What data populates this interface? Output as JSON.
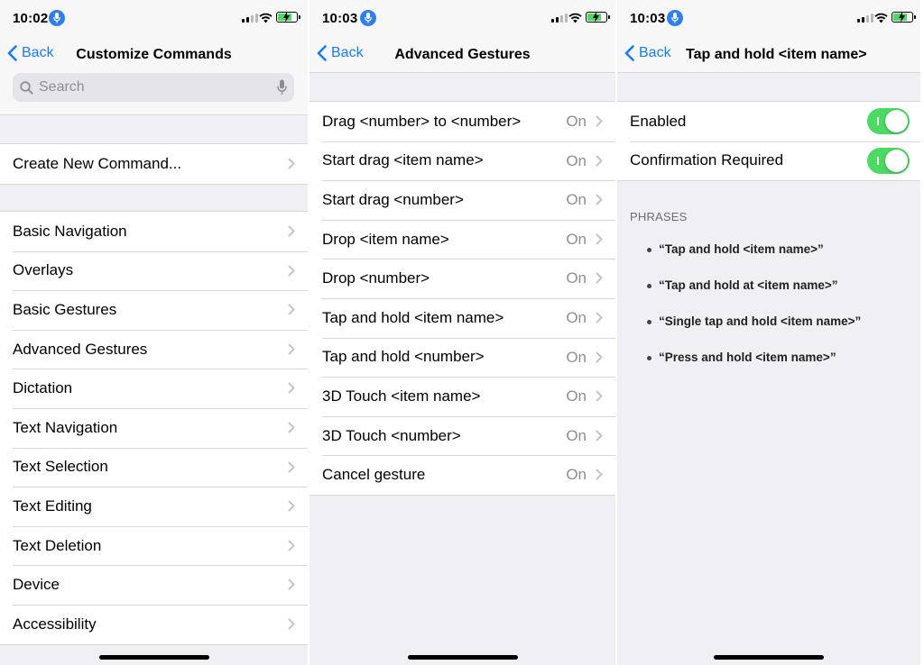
{
  "screens": [
    {
      "status": {
        "time": "10:02"
      },
      "nav": {
        "back": "Back",
        "title": "Customize Commands"
      },
      "search": {
        "placeholder": "Search"
      },
      "top_group": [
        {
          "label": "Create New Command..."
        }
      ],
      "items": [
        {
          "label": "Basic Navigation"
        },
        {
          "label": "Overlays"
        },
        {
          "label": "Basic Gestures"
        },
        {
          "label": "Advanced Gestures"
        },
        {
          "label": "Dictation"
        },
        {
          "label": "Text Navigation"
        },
        {
          "label": "Text Selection"
        },
        {
          "label": "Text Editing"
        },
        {
          "label": "Text Deletion"
        },
        {
          "label": "Device"
        },
        {
          "label": "Accessibility"
        }
      ]
    },
    {
      "status": {
        "time": "10:03"
      },
      "nav": {
        "back": "Back",
        "title": "Advanced Gestures"
      },
      "items": [
        {
          "label": "Drag <number> to <number>",
          "value": "On"
        },
        {
          "label": "Start drag <item name>",
          "value": "On"
        },
        {
          "label": "Start drag <number>",
          "value": "On"
        },
        {
          "label": "Drop <item name>",
          "value": "On"
        },
        {
          "label": "Drop <number>",
          "value": "On"
        },
        {
          "label": "Tap and hold <item name>",
          "value": "On"
        },
        {
          "label": "Tap and hold <number>",
          "value": "On"
        },
        {
          "label": "3D Touch <item name>",
          "value": "On"
        },
        {
          "label": "3D Touch <number>",
          "value": "On"
        },
        {
          "label": "Cancel gesture",
          "value": "On"
        }
      ]
    },
    {
      "status": {
        "time": "10:03"
      },
      "nav": {
        "back": "Back",
        "title": "Tap and hold <item name>"
      },
      "toggles": [
        {
          "label": "Enabled",
          "on": true
        },
        {
          "label": "Confirmation Required",
          "on": true
        }
      ],
      "section_header": "PHRASES",
      "phrases": [
        "“Tap and hold <item name>”",
        "“Tap and hold at <item name>”",
        "“Single tap and hold <item name>”",
        "“Press and hold <item name>”"
      ]
    }
  ],
  "colors": {
    "accent": "#1a7cf2",
    "toggle_on": "#4cd964",
    "background": "#efeff4",
    "mic_badge": "#2f80ed"
  }
}
